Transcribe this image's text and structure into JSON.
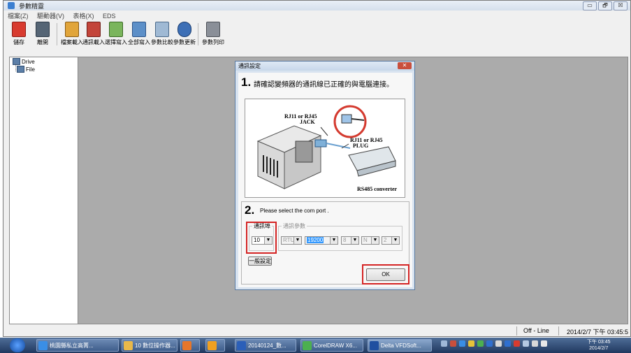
{
  "window": {
    "title": "參數精靈",
    "controls": [
      "▭",
      "🗗",
      "☒"
    ]
  },
  "menu": [
    {
      "label": "檔案(Z)"
    },
    {
      "label": "驅動器(V)"
    },
    {
      "label": "表格(X)"
    },
    {
      "label": "EDS"
    }
  ],
  "toolbar": {
    "save": "儲存",
    "exit": "離開",
    "file_load": "檔案載入",
    "comm_load": "通訊載入",
    "select_write": "選擇寫入",
    "write_all": "全部寫入",
    "compare": "參數比較",
    "update": "參數更新",
    "print": "參數列印"
  },
  "tree": {
    "items": [
      {
        "label": "Drive"
      },
      {
        "label": "File"
      }
    ]
  },
  "dialog": {
    "title": "通訊設定",
    "close": "✕",
    "step1": {
      "number": "1.",
      "text": "請確認變頻器的通訊線已正確的與電腦連接。"
    },
    "illustration": {
      "jack_label": "RJ11 or RJ45",
      "jack_sub": "JACK",
      "plug_label": "RJ11 or RJ45",
      "plug_sub": "PLUG",
      "converter_label": "RS485 converter"
    },
    "step2": {
      "number": "2.",
      "text": "Please select the com port ."
    },
    "port_group_label": "通訊埠",
    "port_value": "10",
    "params_group_label": "通訊參數",
    "params": {
      "mode": "RTU",
      "baud": "19200",
      "data_bits": "8",
      "parity": "N",
      "stop_bits": "2"
    },
    "general_button": "一般設定",
    "ok_button": "OK"
  },
  "statusbar": {
    "mode": "Off - Line",
    "datetime": "2014/2/7 下午 03:45:5"
  },
  "taskbar": {
    "buttons": [
      {
        "label": "桃園縣私立高菁..."
      },
      {
        "label": "10 數位操作器..."
      },
      {
        "label": ""
      },
      {
        "label": ""
      },
      {
        "label": "20140124_數..."
      },
      {
        "label": "CorelDRAW X6..."
      },
      {
        "label": "Delta VFDSoft..."
      }
    ],
    "clock_time": "下午 03:45",
    "clock_date": "2014/2/7"
  },
  "colors": {
    "highlight_box": "#d42424",
    "selection": "#3399ff",
    "taskbar": "#2a4672"
  }
}
